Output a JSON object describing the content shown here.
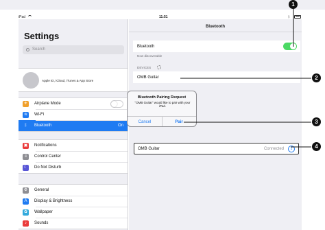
{
  "status_bar": {
    "device": "iPad",
    "time": "11:51"
  },
  "sidebar": {
    "title": "Settings",
    "search_placeholder": "Search",
    "profile_text": "Apple ID, iCloud, iTunes & App Store",
    "group1": [
      {
        "label": "Airplane Mode",
        "icon": "airplane-icon",
        "color": "#f0a02c",
        "glyph": "✈"
      },
      {
        "label": "Wi-Fi",
        "icon": "wifi-icon",
        "color": "#1f7bf2",
        "glyph": "≋"
      },
      {
        "label": "Bluetooth",
        "icon": "bluetooth-icon",
        "color": "#1f7bf2",
        "glyph": "ᛒ",
        "value": "On",
        "selected": true
      }
    ],
    "group2": [
      {
        "label": "Notifications",
        "icon": "notifications-icon",
        "color": "#ea3b3b",
        "glyph": "▣"
      },
      {
        "label": "Control Center",
        "icon": "control-center-icon",
        "color": "#8e8e93",
        "glyph": "≡"
      },
      {
        "label": "Do Not Disturb",
        "icon": "moon-icon",
        "color": "#5856d6",
        "glyph": "☾"
      }
    ],
    "group3": [
      {
        "label": "General",
        "icon": "gear-icon",
        "color": "#8e8e93",
        "glyph": "⚙"
      },
      {
        "label": "Display & Brightness",
        "icon": "display-icon",
        "color": "#1f7bf2",
        "glyph": "A"
      },
      {
        "label": "Wallpaper",
        "icon": "wallpaper-icon",
        "color": "#33aadc",
        "glyph": "✿"
      },
      {
        "label": "Sounds",
        "icon": "sounds-icon",
        "color": "#ea3b3b",
        "glyph": "♪"
      }
    ]
  },
  "detail": {
    "nav_title": "Bluetooth",
    "bluetooth_label": "Bluetooth",
    "bluetooth_on": true,
    "discoverable_text": "Now discoverable",
    "devices_header": "DEVICES",
    "device_name": "OMB Guitar",
    "connected_device": {
      "name": "OMB Guitar",
      "status": "Connected"
    }
  },
  "alert": {
    "title": "Bluetooth Pairing Request",
    "message": "\"OMB Guitar\" would like to pair with your iPad.",
    "cancel_label": "Cancel",
    "pair_label": "Pair"
  },
  "callouts": [
    "1",
    "2",
    "3",
    "4"
  ],
  "colors": {
    "accent": "#1f7bf2",
    "toggle_on": "#4cd964",
    "callout": "#111111"
  }
}
